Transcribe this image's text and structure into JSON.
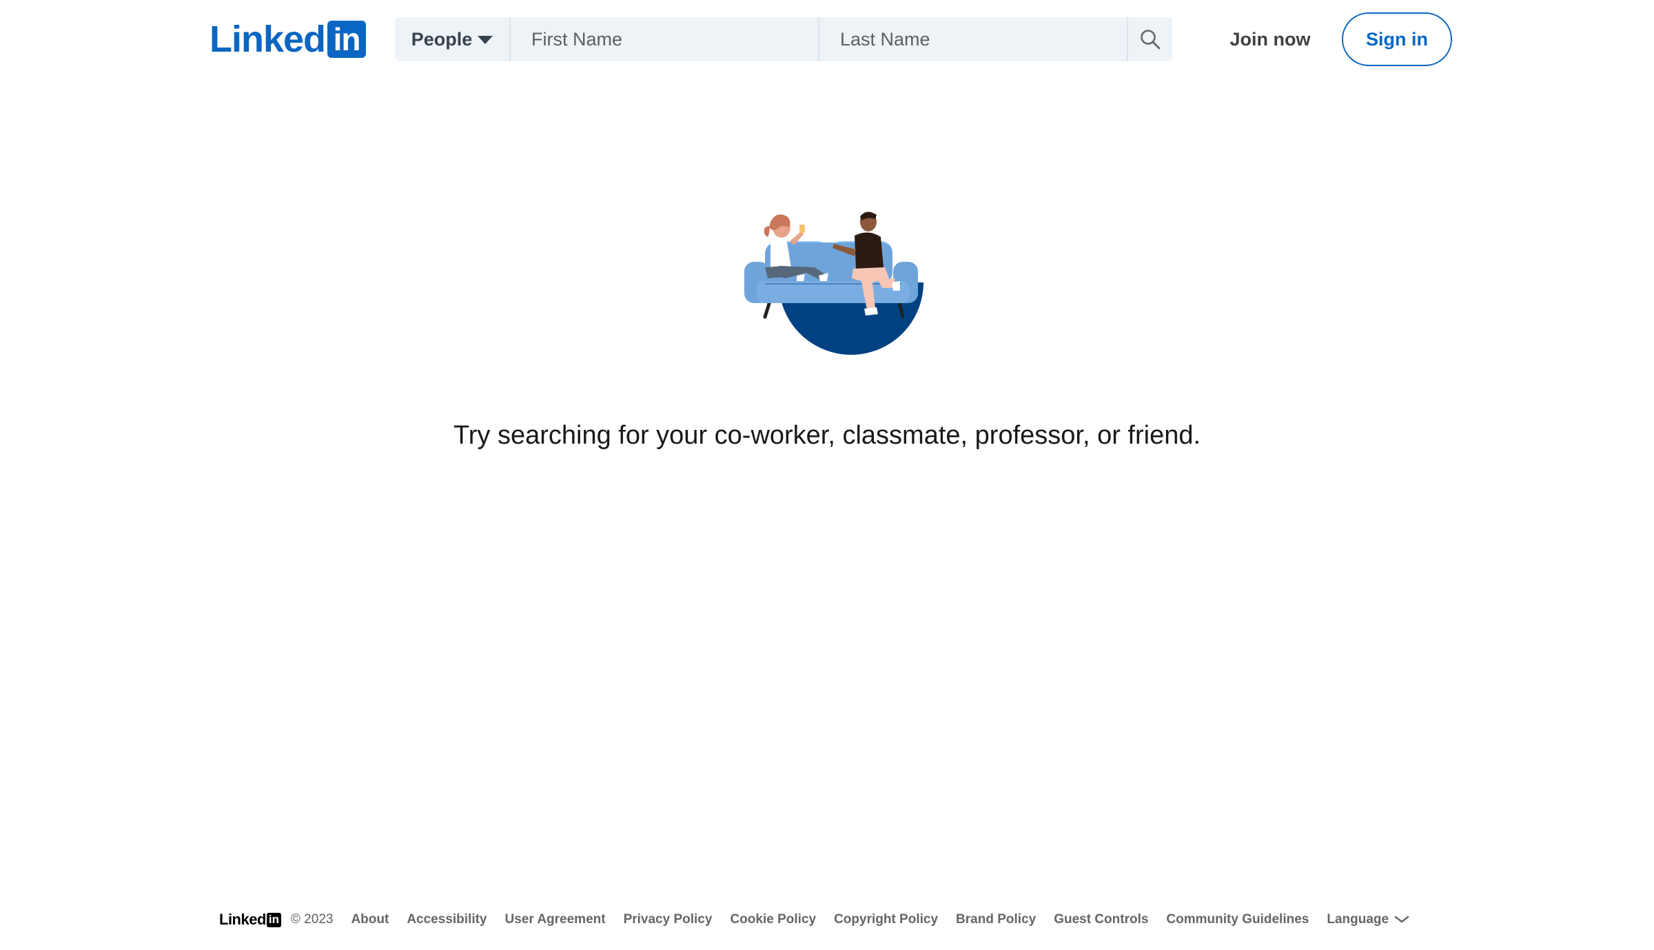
{
  "brand": {
    "logo_word": "Linked",
    "logo_box": "in",
    "color": "#0a66c2"
  },
  "search": {
    "type_label": "People",
    "first_name_placeholder": "First Name",
    "last_name_placeholder": "Last Name",
    "search_icon": "search-icon",
    "dropdown_icon": "caret-down-icon"
  },
  "header": {
    "join_label": "Join now",
    "signin_label": "Sign in"
  },
  "main": {
    "illustration": "couch-conversation-illustration",
    "message": "Try searching for your co-worker, classmate, professor, or friend."
  },
  "footer": {
    "logo_word": "Linked",
    "logo_box": "in",
    "copyright": "© 2023",
    "links": [
      "About",
      "Accessibility",
      "User Agreement",
      "Privacy Policy",
      "Cookie Policy",
      "Copyright Policy",
      "Brand Policy",
      "Guest Controls",
      "Community Guidelines"
    ],
    "language_label": "Language",
    "language_icon": "chevron-down-icon"
  }
}
